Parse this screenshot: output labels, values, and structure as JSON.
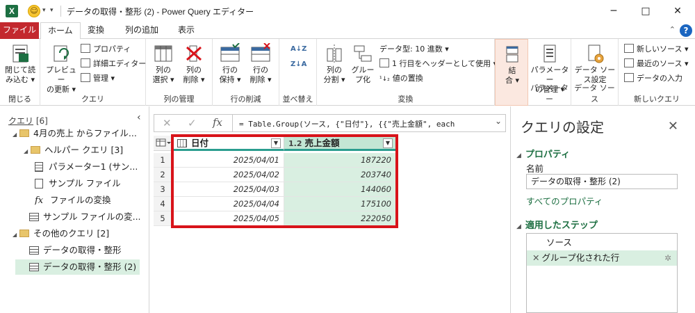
{
  "titlebar": {
    "title": "データの取得・整形 (2) - Power Query エディター",
    "app_logo": "X",
    "smiley": "☺",
    "minimize": "─",
    "maximize": "□",
    "close": "✕"
  },
  "tabs": {
    "file": "ファイル",
    "home": "ホーム",
    "transform": "変換",
    "add_column": "列の追加",
    "view": "表示",
    "help": "?"
  },
  "ribbon": {
    "close_group": {
      "btn_line1": "閉じて読",
      "btn_line2": "み込む ▾",
      "label": "閉じる"
    },
    "query_group": {
      "preview_line1": "プレビュー",
      "preview_line2": "の更新 ▾",
      "properties": "プロパティ",
      "advanced_editor": "詳細エディター",
      "manage": "管理 ▾",
      "label": "クエリ"
    },
    "columns_group": {
      "choose_line1": "列の",
      "choose_line2": "選択 ▾",
      "remove_line1": "列の",
      "remove_line2": "削除 ▾",
      "label": "列の管理"
    },
    "rows_group": {
      "keep_line1": "行の",
      "keep_line2": "保持 ▾",
      "remove_line1": "行の",
      "remove_line2": "削除 ▾",
      "label": "行の削減"
    },
    "sort_group": {
      "label": "並べ替え",
      "az": "A↓Z",
      "za": "Z↓A"
    },
    "transform_group": {
      "split_line1": "列の",
      "split_line2": "分割 ▾",
      "group_line1": "グルー",
      "group_line2": "プ化",
      "data_type": "データ型: 10 進数 ▾",
      "first_row_header": "1 行目をヘッダーとして使用 ▾",
      "replace_values": "値の置換",
      "label": "変換"
    },
    "combine_group": {
      "line1": "結",
      "line2": "合 ▾"
    },
    "params_group": {
      "line1": "パラメーター",
      "line2": "の管理 ▾",
      "label": "パラメーター"
    },
    "datasource_group": {
      "line1": "データ ソー",
      "line2": "ス設定",
      "label": "データ ソース"
    },
    "newquery_group": {
      "new_source": "新しいソース ▾",
      "recent_sources": "最近のソース ▾",
      "enter_data": "データの入力",
      "label": "新しいクエリ"
    }
  },
  "left_pane": {
    "header": "クエリ",
    "count": "[6]",
    "collapse": "‹",
    "items": [
      {
        "label": "4月の売上 からファイル..."
      },
      {
        "label": "ヘルパー クエリ [3]"
      },
      {
        "label": "パラメーター1 (サン..."
      },
      {
        "label": "サンプル ファイル"
      },
      {
        "label": "ファイルの変換"
      },
      {
        "label": "サンプル ファイルの変..."
      },
      {
        "label": "その他のクエリ [2]"
      },
      {
        "label": "データの取得・整形"
      },
      {
        "label": "データの取得・整形 (2)"
      }
    ]
  },
  "formula_bar": {
    "cancel": "✕",
    "commit": "✓",
    "fx": "fx",
    "text": "= Table.Group(ソース, {\"日付\"}, {{\"売上金額\", each",
    "dropdown": "⌄"
  },
  "grid": {
    "columns": [
      {
        "type": "",
        "name": "日付"
      },
      {
        "type": "1.2",
        "name": "売上金額"
      }
    ],
    "rows": [
      {
        "num": "1",
        "date": "2025/04/01",
        "amount": "187220"
      },
      {
        "num": "2",
        "date": "2025/04/02",
        "amount": "203740"
      },
      {
        "num": "3",
        "date": "2025/04/03",
        "amount": "144060"
      },
      {
        "num": "4",
        "date": "2025/04/04",
        "amount": "175100"
      },
      {
        "num": "5",
        "date": "2025/04/05",
        "amount": "222050"
      }
    ]
  },
  "right_pane": {
    "title": "クエリの設定",
    "close": "✕",
    "properties_header": "プロパティ",
    "name_label": "名前",
    "name_value": "データの取得・整形 (2)",
    "all_properties": "すべてのプロパティ",
    "steps_header": "適用したステップ",
    "steps": [
      {
        "label": "ソース"
      },
      {
        "label": "グループ化された行"
      }
    ]
  },
  "colors": {
    "excel_green": "#1d6f42",
    "file_tab": "#c3282e",
    "highlight": "#d8131a",
    "selection": "#d9efe1"
  }
}
